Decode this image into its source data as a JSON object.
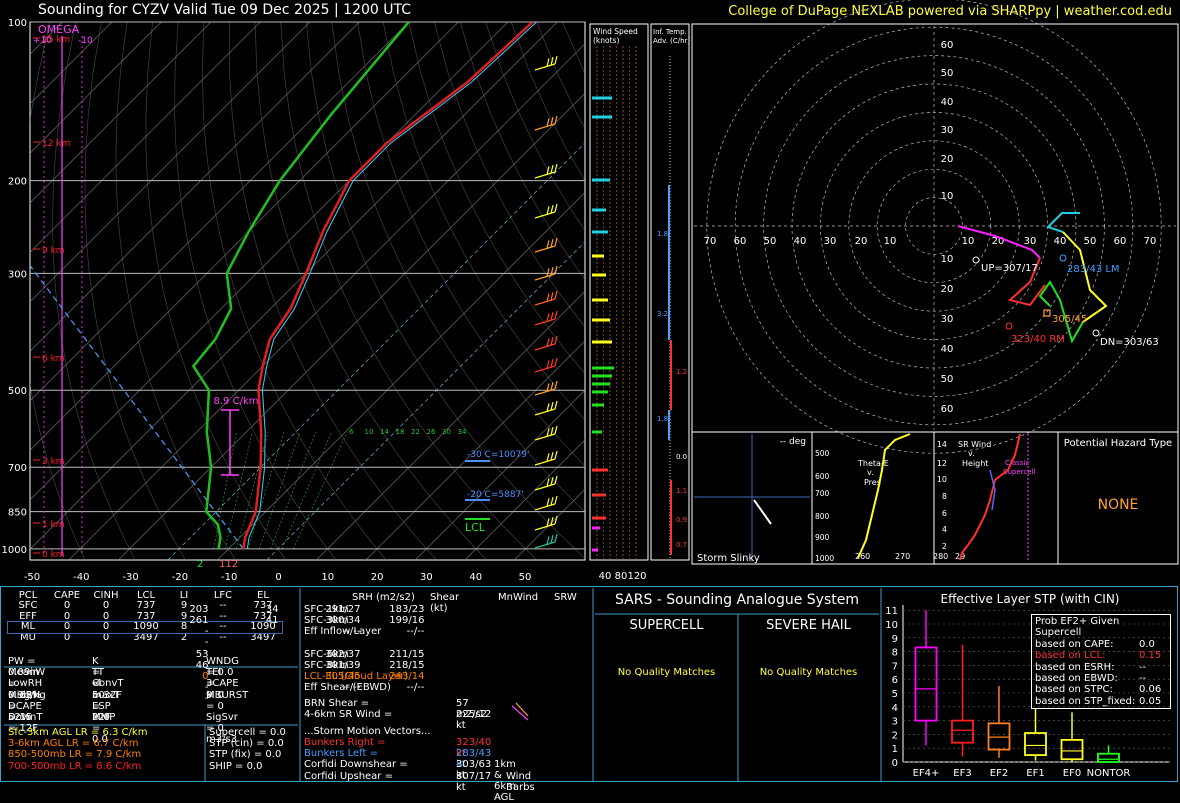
{
  "header": {
    "title": "Sounding for CYZV Valid  Tue 09 Dec 2025 | 1200 UTC",
    "credit": "College of DuPage NEXLAB powered via SHARPpy | weather.cod.edu"
  },
  "chart_data": [
    {
      "type": "line",
      "name": "skew-t",
      "pressure_levels": [
        "100",
        "200",
        "300",
        "500",
        "700",
        "850",
        "1000"
      ],
      "temp_ticks": [
        "-50",
        "-40",
        "-30",
        "-20",
        "-10",
        "0",
        "10",
        "20",
        "30",
        "40",
        "50"
      ],
      "height_labels": [
        "15 km",
        "12 km",
        "9 km",
        "6 km",
        "3 km",
        "1 km",
        "0 km"
      ],
      "omega_label": "OMEGA",
      "omega_ticks": [
        "+10",
        "-10"
      ],
      "lapse_label": "8.9 C/km",
      "c30_label": "-30 C=10079'",
      "c20_label": "-20 C=5887'",
      "lcl_label": "LCL",
      "surface_values": [
        "2",
        "112"
      ],
      "mixing_ratio_labels": [
        "6",
        "10",
        "14",
        "18",
        "22",
        "26",
        "30",
        "34"
      ],
      "temperature": [
        [
          1000,
          -7
        ],
        [
          950,
          -9
        ],
        [
          850,
          -12
        ],
        [
          700,
          -20
        ],
        [
          600,
          -27
        ],
        [
          500,
          -36
        ],
        [
          450,
          -40
        ],
        [
          400,
          -44
        ],
        [
          350,
          -46
        ],
        [
          300,
          -50
        ],
        [
          250,
          -55
        ],
        [
          200,
          -60
        ],
        [
          170,
          -60
        ],
        [
          130,
          -56
        ],
        [
          100,
          -55
        ]
      ],
      "dewpoint": [
        [
          1000,
          -12
        ],
        [
          950,
          -14
        ],
        [
          900,
          -17
        ],
        [
          850,
          -22
        ],
        [
          700,
          -30
        ],
        [
          600,
          -38
        ],
        [
          500,
          -46
        ],
        [
          450,
          -54
        ],
        [
          400,
          -55
        ],
        [
          350,
          -58
        ],
        [
          300,
          -66
        ],
        [
          250,
          -70
        ],
        [
          200,
          -74
        ],
        [
          150,
          -77
        ],
        [
          100,
          -80
        ]
      ]
    },
    {
      "type": "bar",
      "name": "wind-speed",
      "title": "Wind Speed (knots)",
      "ticks": [
        "40",
        "80",
        "120"
      ]
    },
    {
      "type": "bar",
      "name": "inferred-temp-advection",
      "title": "Inf. Temp. Adv. (C/hr)",
      "labels": [
        "1.8",
        "3.2",
        "1.2",
        "1.8",
        "0.0",
        "1.1",
        "0.9",
        "0.7"
      ]
    },
    {
      "type": "line",
      "name": "hodograph",
      "ring_labels": [
        "60",
        "50",
        "40",
        "30",
        "20",
        "10",
        "0"
      ],
      "x_labels": [
        "70",
        "60",
        "50",
        "40",
        "30",
        "20",
        "10",
        "10",
        "20",
        "30",
        "40",
        "50",
        "60",
        "70"
      ],
      "y_labels": [
        "60",
        "50",
        "40",
        "30",
        "20",
        "10",
        "10",
        "20",
        "30",
        "40",
        "50",
        "60"
      ],
      "markers": {
        "up": "UP=307/17",
        "lm": "283/43 LM",
        "mean": "305/45",
        "rm": "323/40 RM",
        "dn": "DN=303/63"
      }
    },
    {
      "type": "line",
      "name": "storm-slinky",
      "title": "-- deg",
      "label": "Storm Slinky"
    },
    {
      "type": "line",
      "name": "theta-e",
      "title": "Theta-E v. Pres",
      "y_labels": [
        "500",
        "600",
        "700",
        "800",
        "900",
        "1000"
      ],
      "x_labels": [
        "260",
        "270",
        "280",
        "29"
      ]
    },
    {
      "type": "line",
      "name": "sr-wind",
      "title": "SR Wind v. Height",
      "annotation": "Classic Supercell",
      "y_labels": [
        "14",
        "12",
        "10",
        "8",
        "6",
        "4",
        "2"
      ]
    },
    {
      "type": "bar",
      "name": "effective-layer-stp",
      "title": "Effective Layer STP (with CIN)",
      "categories": [
        "EF4+",
        "EF3",
        "EF2",
        "EF1",
        "EF0",
        "NONTOR"
      ],
      "y_labels": [
        "0",
        "1",
        "2",
        "3",
        "4",
        "5",
        "6",
        "7",
        "8",
        "9",
        "10",
        "11"
      ],
      "boxes": [
        {
          "name": "EF4+",
          "lo": 1.2,
          "q1": 3.0,
          "med": 5.3,
          "q3": 8.3,
          "hi": 11.0,
          "color": "#ff00ff"
        },
        {
          "name": "EF3",
          "lo": 0.4,
          "q1": 1.4,
          "med": 2.3,
          "q3": 3.0,
          "hi": 8.5,
          "color": "#ff2020"
        },
        {
          "name": "EF2",
          "lo": 0.3,
          "q1": 0.9,
          "med": 1.8,
          "q3": 2.8,
          "hi": 5.5,
          "color": "#ff8020"
        },
        {
          "name": "EF1",
          "lo": 0.1,
          "q1": 0.5,
          "med": 1.2,
          "q3": 2.1,
          "hi": 3.9,
          "color": "#ffff20"
        },
        {
          "name": "EF0",
          "lo": 0.0,
          "q1": 0.2,
          "med": 0.8,
          "q3": 1.6,
          "hi": 3.6,
          "color": "#ffff20"
        },
        {
          "name": "NONTOR",
          "lo": 0.0,
          "q1": 0.0,
          "med": 0.2,
          "q3": 0.6,
          "hi": 1.2,
          "color": "#20ff20"
        }
      ]
    }
  ],
  "hazard": {
    "title": "Potential Hazard Type",
    "value": "NONE"
  },
  "parcels": {
    "headers": [
      "PCL",
      "CAPE",
      "CINH",
      "LCL",
      "LI",
      "LFC",
      "EL"
    ],
    "rows": [
      [
        "SFC",
        "0",
        "0",
        "737",
        "9",
        "--",
        "737"
      ],
      [
        "EFF",
        "0",
        "0",
        "737",
        "9",
        "--",
        "737"
      ],
      [
        "ML",
        "0",
        "0",
        "1090",
        "8",
        "--",
        "1090"
      ],
      [
        "MU",
        "0",
        "0",
        "3497",
        "2",
        "--",
        "3497"
      ]
    ]
  },
  "indices": [
    [
      "PW = 0.09in",
      "K = -4",
      "WNDG = 0.0"
    ],
    [
      "MeanW = 0.9g/kg",
      "TT = 50",
      "TEI = 9"
    ],
    [
      "LowRH = 63%",
      "ConvT = 32F",
      "3CAPE = 0"
    ],
    [
      "MidRH = 52%",
      "maxT = 22F",
      "MBURST = 0"
    ],
    [
      "DCAPE = 15",
      "ESP = 0",
      ""
    ],
    [
      "DownT = 12F",
      "MMP = 0.0",
      "SigSvr = 0 m3/s3"
    ]
  ],
  "lapse_rates": [
    {
      "text": "Sfc-3km AGL LR = 6.3 C/km",
      "color": "#ffff40"
    },
    {
      "text": "3-6km AGL LR = 6.7 C/km",
      "color": "#ff8000"
    },
    {
      "text": "850-500mb LR = 7.9 C/km",
      "color": "#ff8000"
    },
    {
      "text": "700-500mb LR = 8.6 C/km",
      "color": "#ff2020"
    }
  ],
  "composites": [
    "Supercell = 0.0",
    "STP (cin) = 0.0",
    "STP (fix) = 0.0",
    "SHIP = 0.0"
  ],
  "kinematics": {
    "headers": [
      "SRH (m2/s2)",
      "Shear (kt)",
      "MnWind",
      "SRW"
    ],
    "rows": [
      {
        "label": "SFC-1km",
        "v": [
          "203",
          "34",
          "291/27",
          "183/23"
        ],
        "color": "#ffffff"
      },
      {
        "label": "SFC-3km",
        "v": [
          "261",
          "41",
          "300/34",
          "199/16"
        ],
        "color": "#ffffff"
      },
      {
        "label": "Eff Inflow Layer",
        "v": [
          "--",
          "",
          "--/--",
          "--/--"
        ],
        "color": "#ffffff"
      },
      {
        "label": "",
        "v": [
          "",
          "",
          "",
          ""
        ],
        "color": "#ffffff"
      },
      {
        "label": "SFC-6km",
        "v": [
          "53",
          "",
          "302/37",
          "211/15"
        ],
        "color": "#ffffff"
      },
      {
        "label": "SFC-8km",
        "v": [
          "46",
          "",
          "301/39",
          "218/15"
        ],
        "color": "#ffffff"
      },
      {
        "label": "LCL-EL (Cloud Layer)",
        "v": [
          "0",
          "",
          "305/45",
          "243/14"
        ],
        "color": "#ff8000"
      },
      {
        "label": "Eff Shear (EBWD)",
        "v": [
          "--",
          "",
          "--/--",
          "--/--"
        ],
        "color": "#ffffff"
      }
    ],
    "brn_shear": "BRN Shear =",
    "brn_value": "57 m2/s2",
    "sr_wind": "4-6km SR Wind =",
    "sr_value": "225/12 kt",
    "storm_title": "...Storm Motion Vectors...",
    "vectors": [
      {
        "label": "Bunkers Right =",
        "value": "323/40 kt",
        "color": "#ff3030"
      },
      {
        "label": "Bunkers Left =",
        "value": "283/43 kt",
        "color": "#40a0ff"
      },
      {
        "label": "Corfidi Downshear =",
        "value": "303/63 kt",
        "color": "#ffffff"
      },
      {
        "label": "Corfidi Upshear =",
        "value": "307/17 kt",
        "color": "#ffffff"
      }
    ],
    "barb_caption": "1km & 6km AGL Wind Barbs"
  },
  "sars": {
    "title": "SARS - Sounding Analogue System",
    "supercell": "SUPERCELL",
    "hail": "SEVERE HAIL",
    "supercell_result": "No Quality Matches",
    "hail_result": "No Quality Matches"
  },
  "stp_legend": {
    "title": "Prob EF2+ Given Supercell",
    "rows": [
      {
        "label": "based on CAPE:",
        "value": "0.0",
        "color": "#ffffff"
      },
      {
        "label": "based on LCL:",
        "value": "0.15",
        "color": "#ff3030"
      },
      {
        "label": "based on ESRH:",
        "value": "--",
        "color": "#ffffff"
      },
      {
        "label": "based on EBWD:",
        "value": "--",
        "color": "#ffffff"
      },
      {
        "label": "based on STPC:",
        "value": "0.06",
        "color": "#ffffff"
      },
      {
        "label": "based on STP_fixed:",
        "value": "0.05",
        "color": "#ffffff"
      }
    ]
  }
}
